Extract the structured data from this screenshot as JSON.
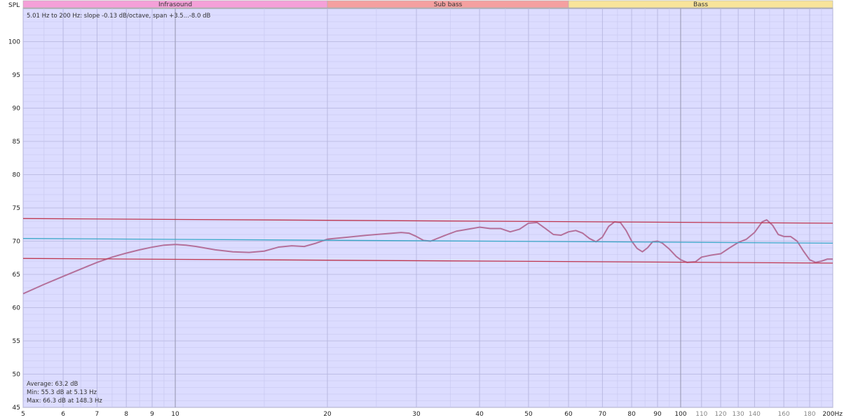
{
  "chart_data": {
    "type": "line",
    "ylabel": "SPL",
    "x_unit": "Hz",
    "x_scale": "log",
    "xlim": [
      5,
      200
    ],
    "ylim": [
      45,
      105
    ],
    "grid": true,
    "annotation": "5.01 Hz to 200 Hz: slope -0.13 dB/octave, span +3.5...-8.0 dB",
    "stats": [
      "Average: 63.2 dB",
      "Min: 55.3 dB at 5.13 Hz",
      "Max: 66.3 dB at 148.3 Hz"
    ],
    "bands": [
      {
        "name": "Infrasound",
        "from": 5,
        "to": 20,
        "color": "#f4a0d8"
      },
      {
        "name": "Sub bass",
        "from": 20,
        "to": 60,
        "color": "#f4a0a0"
      },
      {
        "name": "Bass",
        "from": 60,
        "to": 200,
        "color": "#f8e49a"
      }
    ],
    "y_ticks": [
      {
        "v": 45,
        "label": "45"
      },
      {
        "v": 50,
        "label": "50"
      },
      {
        "v": 55,
        "label": "55"
      },
      {
        "v": 60,
        "label": "60"
      },
      {
        "v": 65,
        "label": "65"
      },
      {
        "v": 70,
        "label": "70"
      },
      {
        "v": 75,
        "label": "75"
      },
      {
        "v": 80,
        "label": "80"
      },
      {
        "v": 85,
        "label": "85"
      },
      {
        "v": 90,
        "label": "90"
      },
      {
        "v": 95,
        "label": "95"
      },
      {
        "v": 100,
        "label": "100"
      }
    ],
    "x_ticks": [
      {
        "v": 5,
        "label": "5",
        "minor": false
      },
      {
        "v": 6,
        "label": "6",
        "minor": false
      },
      {
        "v": 7,
        "label": "7",
        "minor": false
      },
      {
        "v": 8,
        "label": "8",
        "minor": false
      },
      {
        "v": 9,
        "label": "9",
        "minor": false
      },
      {
        "v": 10,
        "label": "10",
        "minor": false
      },
      {
        "v": 20,
        "label": "20",
        "minor": false
      },
      {
        "v": 30,
        "label": "30",
        "minor": false
      },
      {
        "v": 40,
        "label": "40",
        "minor": false
      },
      {
        "v": 50,
        "label": "50",
        "minor": false
      },
      {
        "v": 60,
        "label": "60",
        "minor": false
      },
      {
        "v": 70,
        "label": "70",
        "minor": false
      },
      {
        "v": 80,
        "label": "80",
        "minor": false
      },
      {
        "v": 90,
        "label": "90",
        "minor": false
      },
      {
        "v": 100,
        "label": "100",
        "minor": false
      },
      {
        "v": 110,
        "label": "110",
        "minor": true
      },
      {
        "v": 120,
        "label": "120",
        "minor": true
      },
      {
        "v": 130,
        "label": "130",
        "minor": true
      },
      {
        "v": 140,
        "label": "140",
        "minor": true
      },
      {
        "v": 160,
        "label": "160",
        "minor": true
      },
      {
        "v": 180,
        "label": "180",
        "minor": true
      },
      {
        "v": 200,
        "label": "200Hz",
        "minor": false
      }
    ],
    "series": [
      {
        "role": "response",
        "color": "#b4709a",
        "points": [
          [
            5,
            62.1
          ],
          [
            5.5,
            63.5
          ],
          [
            6,
            64.7
          ],
          [
            6.5,
            65.8
          ],
          [
            7,
            66.8
          ],
          [
            7.5,
            67.6
          ],
          [
            8,
            68.2
          ],
          [
            8.5,
            68.7
          ],
          [
            9,
            69.1
          ],
          [
            9.5,
            69.4
          ],
          [
            10,
            69.5
          ],
          [
            10.5,
            69.4
          ],
          [
            11,
            69.2
          ],
          [
            12,
            68.7
          ],
          [
            13,
            68.4
          ],
          [
            14,
            68.3
          ],
          [
            15,
            68.5
          ],
          [
            16,
            69.1
          ],
          [
            17,
            69.3
          ],
          [
            18,
            69.2
          ],
          [
            19,
            69.7
          ],
          [
            20,
            70.3
          ],
          [
            22,
            70.6
          ],
          [
            24,
            70.9
          ],
          [
            26,
            71.1
          ],
          [
            28,
            71.3
          ],
          [
            29,
            71.2
          ],
          [
            30,
            70.7
          ],
          [
            31,
            70.1
          ],
          [
            32,
            70.0
          ],
          [
            34,
            70.8
          ],
          [
            36,
            71.5
          ],
          [
            38,
            71.8
          ],
          [
            40,
            72.1
          ],
          [
            42,
            71.9
          ],
          [
            44,
            71.9
          ],
          [
            46,
            71.4
          ],
          [
            48,
            71.8
          ],
          [
            50,
            72.7
          ],
          [
            52,
            72.8
          ],
          [
            54,
            71.9
          ],
          [
            56,
            71.0
          ],
          [
            58,
            70.9
          ],
          [
            60,
            71.4
          ],
          [
            62,
            71.6
          ],
          [
            64,
            71.2
          ],
          [
            66,
            70.4
          ],
          [
            68,
            69.9
          ],
          [
            70,
            70.6
          ],
          [
            72,
            72.2
          ],
          [
            74,
            72.9
          ],
          [
            76,
            72.8
          ],
          [
            78,
            71.6
          ],
          [
            80,
            70.0
          ],
          [
            82,
            68.9
          ],
          [
            84,
            68.4
          ],
          [
            86,
            69.0
          ],
          [
            88,
            69.9
          ],
          [
            90,
            70.0
          ],
          [
            92,
            69.7
          ],
          [
            95,
            68.8
          ],
          [
            98,
            67.7
          ],
          [
            100,
            67.2
          ],
          [
            103,
            66.8
          ],
          [
            107,
            66.9
          ],
          [
            110,
            67.6
          ],
          [
            115,
            67.9
          ],
          [
            120,
            68.1
          ],
          [
            125,
            69.0
          ],
          [
            130,
            69.8
          ],
          [
            135,
            70.3
          ],
          [
            140,
            71.3
          ],
          [
            145,
            72.9
          ],
          [
            148,
            73.2
          ],
          [
            152,
            72.4
          ],
          [
            156,
            71.0
          ],
          [
            160,
            70.7
          ],
          [
            165,
            70.7
          ],
          [
            170,
            70.0
          ],
          [
            175,
            68.5
          ],
          [
            180,
            67.2
          ],
          [
            185,
            66.8
          ],
          [
            190,
            67.0
          ],
          [
            195,
            67.3
          ],
          [
            200,
            67.3
          ]
        ]
      },
      {
        "role": "trend",
        "color": "#3aa8c8",
        "points": [
          [
            5,
            70.4
          ],
          [
            200,
            69.7
          ]
        ]
      },
      {
        "role": "upper-limit",
        "color": "#c03850",
        "points": [
          [
            5,
            73.4
          ],
          [
            200,
            72.7
          ]
        ]
      },
      {
        "role": "lower-limit",
        "color": "#c03850",
        "points": [
          [
            5,
            67.4
          ],
          [
            200,
            66.7
          ]
        ]
      }
    ],
    "colors": {
      "plot_bg": "#dcdcff",
      "grid_minor": "#c6c6ee",
      "grid_major": "#b4b4dc",
      "grid_decade": "#9a9ab4",
      "frame": "#909090"
    }
  }
}
